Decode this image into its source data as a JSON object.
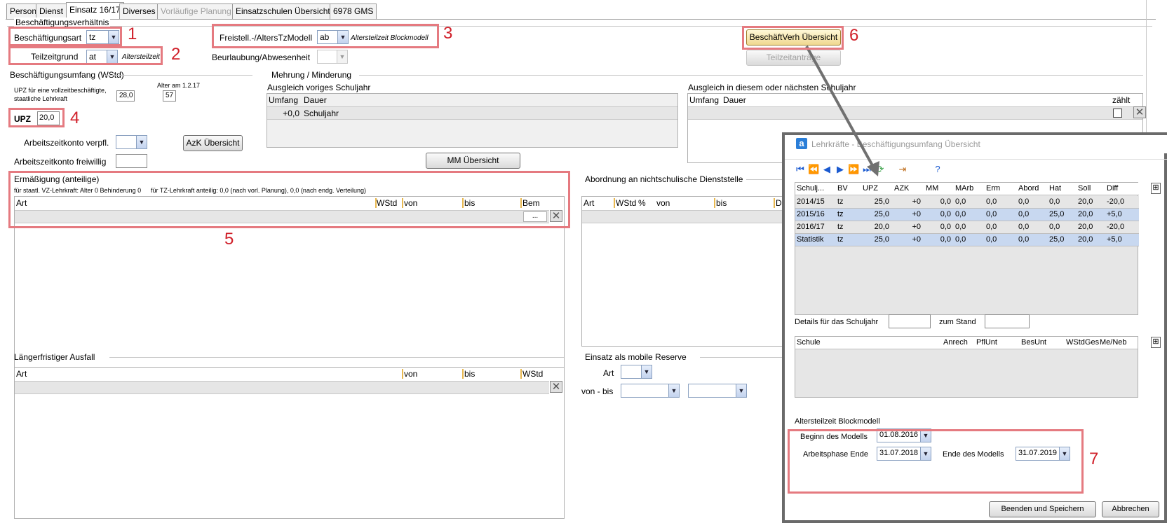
{
  "tabs": [
    {
      "label": "Person",
      "state": "normal"
    },
    {
      "label": "Dienst",
      "state": "normal"
    },
    {
      "label": "Einsatz 16/17",
      "state": "active"
    },
    {
      "label": "Diverses",
      "state": "normal"
    },
    {
      "label": "Vorläufige Planung",
      "state": "disabled"
    },
    {
      "label": "Einsatzschulen Übersicht",
      "state": "normal"
    },
    {
      "label": "6978 GMS",
      "state": "normal"
    }
  ],
  "beschaeftigung": {
    "section_title": "Beschäftigungsverhältnis",
    "art_label": "Beschäftigungsart",
    "art_value": "tz",
    "teilzeitgrund_label": "Teilzeitgrund",
    "teilzeitgrund_value": "at",
    "teilzeitgrund_hint": "Altersteilzeit",
    "freistell_label": "Freistell.-/AltersTzModell",
    "freistell_value": "ab",
    "freistell_hint": "Altersteilzeit Blockmodell",
    "beurlaubung_label": "Beurlaubung/Abwesenheit",
    "uebersicht_button": "BeschäftVerh Übersicht",
    "teilzeitantrag_button": "Teilzeitanträge"
  },
  "umfang": {
    "section_title": "Beschäftigungsumfang (WStd)",
    "upz_desc": "UPZ für eine vollzeitbeschäftigte, staatliche Lehrkraft",
    "upz_voll": "28,0",
    "alter_label": "Alter am 1.2.17",
    "alter_value": "57",
    "upz_label": "UPZ",
    "upz_value": "20,0",
    "azk_verpfl_label": "Arbeitszeitkonto verpfl.",
    "azk_frei_label": "Arbeitszeitkonto freiwillig",
    "azk_button": "AzK Übersicht"
  },
  "mehrung": {
    "section_title": "Mehrung / Minderung",
    "voriges_title": "Ausgleich voriges Schuljahr",
    "col_umfang": "Umfang",
    "col_dauer": "Dauer",
    "row_umfang": "+0,0",
    "row_dauer": "Schuljahr",
    "naechstes_title": "Ausgleich in diesem oder nächsten Schuljahr",
    "col_zaehlt": "zählt",
    "mm_button": "MM Übersicht"
  },
  "ermaessigung": {
    "section_title": "Ermäßigung (anteilige)",
    "info_vz": "für staatl. VZ-Lehrkraft: Alter 0 Behinderung 0",
    "info_tz": "für TZ-Lehrkraft anteilig: 0,0 (nach vorl. Planung), 0,0 (nach endg. Verteilung)",
    "cols": [
      "Art",
      "WStd",
      "von",
      "bis",
      "Bem"
    ],
    "ellipsis": "..."
  },
  "abordnung": {
    "section_title": "Abordnung an nichtschulische Dienststelle",
    "cols": [
      "Art",
      "WStd",
      "%",
      "von",
      "bis",
      "Die"
    ]
  },
  "ausfall": {
    "section_title": "Längerfristiger Ausfall",
    "cols": [
      "Art",
      "von",
      "bis",
      "WStd"
    ]
  },
  "reserve": {
    "section_title": "Einsatz als mobile Reserve",
    "art_label": "Art",
    "vonbis_label": "von - bis"
  },
  "annotations": [
    "1",
    "2",
    "3",
    "4",
    "5",
    "6",
    "7"
  ],
  "dialog": {
    "title": "Lehrkräfte - Beschäftigungsumfang Übersicht",
    "app_icon": "a",
    "columns": [
      "Schulj...",
      "BV",
      "UPZ",
      "AZK",
      "MM",
      "MArb",
      "Erm",
      "Abord",
      "Hat",
      "Soll",
      "Diff"
    ],
    "rows": [
      {
        "schulj": "2014/15",
        "bv": "tz",
        "upz": "25,0",
        "azk": "+0",
        "mm": "0,0",
        "marb": "0,0",
        "erm": "0,0",
        "abord": "0,0",
        "hat": "0,0",
        "soll": "20,0",
        "diff": "-20,0",
        "selected": false
      },
      {
        "schulj": "2015/16",
        "bv": "tz",
        "upz": "25,0",
        "azk": "+0",
        "mm": "0,0",
        "marb": "0,0",
        "erm": "0,0",
        "abord": "0,0",
        "hat": "25,0",
        "soll": "20,0",
        "diff": "+5,0",
        "selected": true
      },
      {
        "schulj": "2016/17",
        "bv": "tz",
        "upz": "20,0",
        "azk": "+0",
        "mm": "0,0",
        "marb": "0,0",
        "erm": "0,0",
        "abord": "0,0",
        "hat": "0,0",
        "soll": "20,0",
        "diff": "-20,0",
        "selected": false
      },
      {
        "schulj": "Statistik",
        "bv": "tz",
        "upz": "25,0",
        "azk": "+0",
        "mm": "0,0",
        "marb": "0,0",
        "erm": "0,0",
        "abord": "0,0",
        "hat": "25,0",
        "soll": "20,0",
        "diff": "+5,0",
        "selected": true
      }
    ],
    "details_label": "Details für das Schuljahr",
    "stand_label": "zum Stand",
    "schule_cols": [
      "Schule",
      "Anrech",
      "PflUnt",
      "BesUnt",
      "WStdGes",
      "Me/Neb"
    ],
    "blockmodell_title": "Altersteilzeit Blockmodell",
    "beginn_label": "Beginn des Modells",
    "beginn_value": "01.08.2016",
    "arbeitsphase_label": "Arbeitsphase Ende",
    "arbeitsphase_value": "31.07.2018",
    "ende_label": "Ende des Modells",
    "ende_value": "31.07.2019",
    "save_button": "Beenden und Speichern",
    "cancel_button": "Abbrechen"
  },
  "colors": {
    "highlight_red": "#e57a80",
    "annotation_red": "#d0202a",
    "selected_row": "#c8d8f0",
    "header_separator": "#e8b850"
  }
}
